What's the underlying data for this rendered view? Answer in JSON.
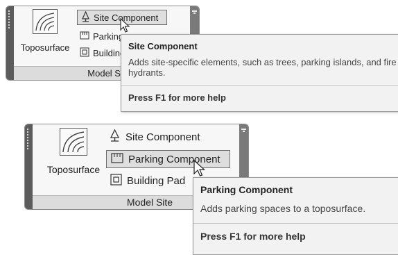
{
  "panel_top": {
    "toposurface_label": "Toposurface",
    "site_component_label": "Site Component",
    "parking_component_label": "Parking Component",
    "building_pad_label": "Building Pad",
    "panel_title": "Model Site",
    "tooltip": {
      "title": "Site Component",
      "description": "Adds site-specific elements, such as trees, parking islands, and fire hydrants.",
      "help": "Press F1 for more help"
    }
  },
  "panel_bottom": {
    "toposurface_label": "Toposurface",
    "site_component_label": "Site Component",
    "parking_component_label": "Parking Component",
    "building_pad_label": "Building Pad",
    "panel_title": "Model Site",
    "tooltip": {
      "title": "Parking Component",
      "description": "Adds parking spaces to a toposurface.",
      "help": "Press F1 for more help"
    }
  },
  "icons": {
    "toposurface": "toposurface-icon",
    "site_component": "tree-icon",
    "parking_component": "parking-icon",
    "building_pad": "building-pad-icon",
    "cursor": "mouse-pointer-icon"
  }
}
